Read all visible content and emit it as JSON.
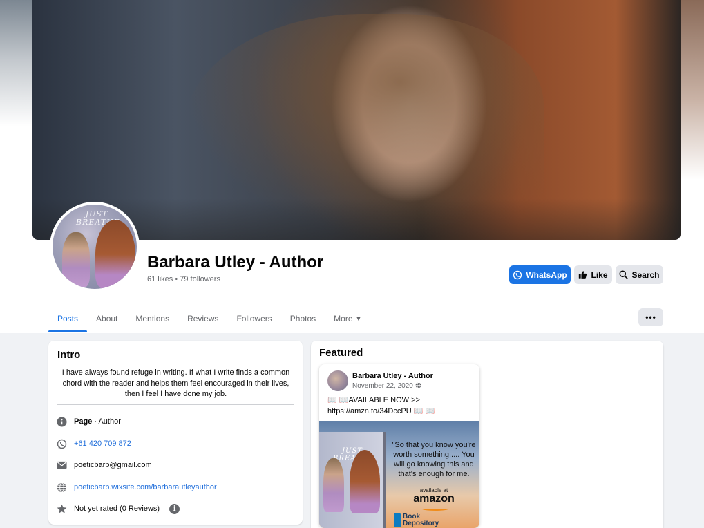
{
  "page": {
    "name": "Barbara Utley - Author",
    "stats": "61 likes • 79 followers",
    "cover_title": "JUST BREATHE"
  },
  "actions": {
    "whatsapp": "WhatsApp",
    "like": "Like",
    "search": "Search",
    "more_dots": "•••"
  },
  "tabs": [
    {
      "label": "Posts",
      "active": true
    },
    {
      "label": "About"
    },
    {
      "label": "Mentions"
    },
    {
      "label": "Reviews"
    },
    {
      "label": "Followers"
    },
    {
      "label": "Photos"
    },
    {
      "label": "More"
    }
  ],
  "intro": {
    "title": "Intro",
    "bio": "I have always found refuge in writing. If what I write finds a common chord with the reader and helps them feel encouraged in their lives, then I feel I have done my job.",
    "category_prefix": "Page",
    "category": " · Author",
    "phone": "+61 420 709 872",
    "email": "poeticbarb@gmail.com",
    "website": "poeticbarb.wixsite.com/barbarautleyauthor",
    "rating": "Not yet rated (0 Reviews)"
  },
  "featured": {
    "title": "Featured",
    "post": {
      "author": "Barbara Utley - Author",
      "date": "November 22, 2020",
      "text": "📖 📖AVAILABLE NOW >> https://amzn.to/34DccPU 📖 📖",
      "image": {
        "book_title": "JUST BREATHE",
        "quote": "\"So that you know you're worth something..... You will go knowing this and that's enough for me.",
        "available": "available at",
        "amazon": "amazon",
        "book_depository": "Book Depository"
      }
    }
  },
  "colors": {
    "accent": "#1b74e4",
    "link": "#216fdb",
    "muted": "#65676b",
    "background": "#f0f2f5"
  },
  "icons": [
    "whatsapp-icon",
    "thumbs-up-icon",
    "search-icon",
    "caret-down-icon",
    "info-icon",
    "phone-icon",
    "mail-icon",
    "globe-icon",
    "star-icon",
    "globe-small-icon"
  ]
}
